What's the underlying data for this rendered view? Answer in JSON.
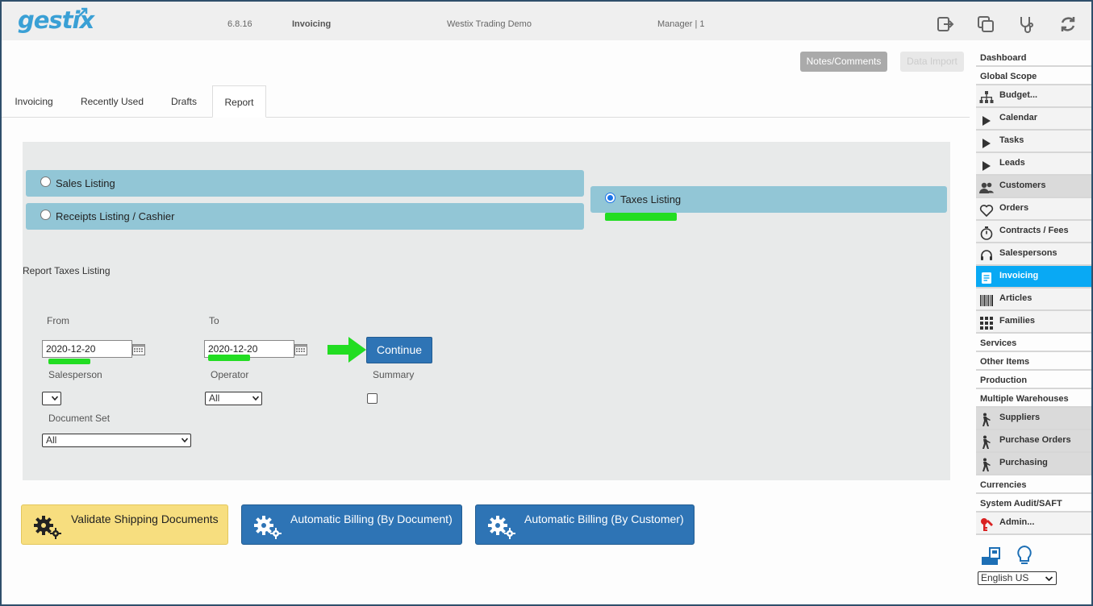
{
  "header": {
    "logo": "gestix",
    "version": "6.8.16",
    "module": "Invoicing",
    "company": "Westix Trading Demo",
    "user": "Manager | 1"
  },
  "top_buttons": {
    "notes": "Notes/Comments",
    "data_import": "Data Import"
  },
  "tabs": [
    {
      "label": "Invoicing",
      "active": false
    },
    {
      "label": "Recently Used",
      "active": false
    },
    {
      "label": "Drafts",
      "active": false
    },
    {
      "label": "Report",
      "active": true
    }
  ],
  "report_options": {
    "sales_listing": "Sales Listing",
    "receipts_listing": "Receipts Listing / Cashier",
    "taxes_listing": "Taxes Listing",
    "selected": "Taxes Listing"
  },
  "report_title": "Report Taxes Listing",
  "form": {
    "from_label": "From",
    "from_value": "2020-12-20",
    "to_label": "To",
    "to_value": "2020-12-20",
    "continue": "Continue",
    "salesperson_label": "Salesperson",
    "salesperson_value": "",
    "operator_label": "Operator",
    "operator_value": "All",
    "summary_label": "Summary",
    "summary_checked": false,
    "document_set_label": "Document Set",
    "document_set_value": "All"
  },
  "actions": {
    "validate": "Validate Shipping Documents",
    "auto_doc": "Automatic Billing (By Document)",
    "auto_customer": "Automatic Billing (By Customer)"
  },
  "sidebar": {
    "items": [
      {
        "label": "Dashboard"
      },
      {
        "label": "Global Scope"
      },
      {
        "label": "Budget...",
        "icon": "org-chart-icon"
      },
      {
        "label": "Calendar",
        "icon": "play-icon"
      },
      {
        "label": "Tasks",
        "icon": "play-icon"
      },
      {
        "label": "Leads",
        "icon": "play-icon"
      },
      {
        "label": "Customers",
        "icon": "users-icon"
      },
      {
        "label": "Orders",
        "icon": "heart-icon"
      },
      {
        "label": "Contracts / Fees",
        "icon": "stopwatch-icon"
      },
      {
        "label": "Salespersons",
        "icon": "headset-icon"
      },
      {
        "label": "Invoicing",
        "icon": "document-icon",
        "active": true
      },
      {
        "label": "Articles",
        "icon": "barcode-icon"
      },
      {
        "label": "Families",
        "icon": "grid-icon"
      },
      {
        "label": "Services"
      },
      {
        "label": "Other Items"
      },
      {
        "label": "Production"
      },
      {
        "label": "Multiple Warehouses"
      },
      {
        "label": "Suppliers",
        "icon": "walker-icon"
      },
      {
        "label": "Purchase Orders",
        "icon": "walker-icon"
      },
      {
        "label": "Purchasing",
        "icon": "walker-icon"
      },
      {
        "label": "Currencies"
      },
      {
        "label": "System Audit/SAFT"
      },
      {
        "label": "Admin...",
        "icon": "admin-icon"
      }
    ],
    "language": "English US"
  },
  "colors": {
    "accent": "#09a9f4",
    "option_bar": "#92c6d6",
    "primary_button": "#2e74b5",
    "validate_button": "#f7de7f",
    "highlight_mark": "#22dd22"
  }
}
